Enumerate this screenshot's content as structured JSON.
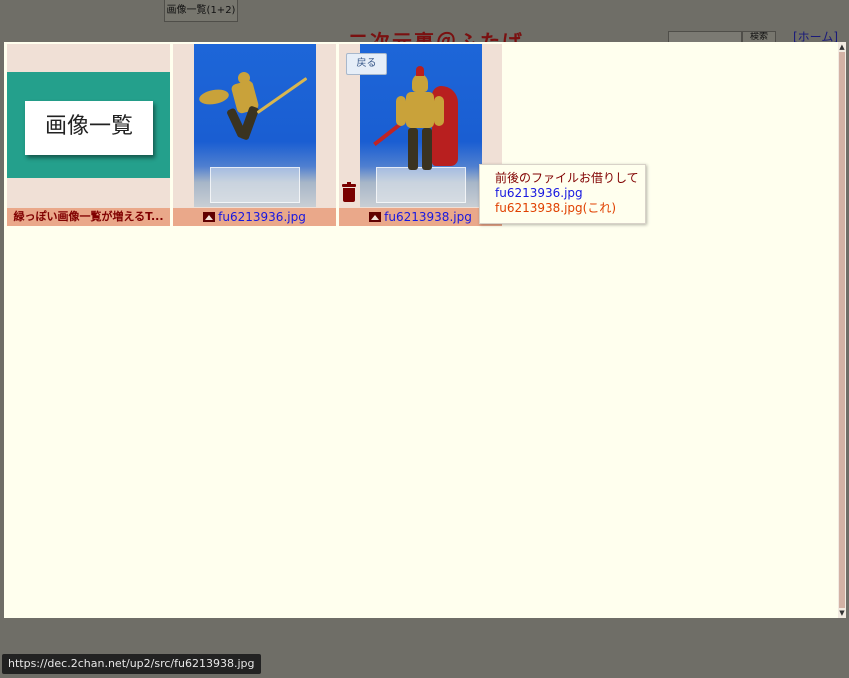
{
  "background_page": {
    "tab_label": "画像一覧(1+2)",
    "site_title": "二次元裏＠ふたば",
    "search_button": "検索",
    "home_link": "[ホーム]"
  },
  "overlay": {
    "back_button": "戻る",
    "tiles": [
      {
        "caption": "緑っぽい画像一覧が増えるT...",
        "thumb_text": "画像一覧"
      },
      {
        "caption": "fu6213936.jpg"
      },
      {
        "caption": "fu6213938.jpg"
      }
    ],
    "popup": {
      "line1": "前後のファイルお借りして",
      "line2": "fu6213936.jpg",
      "line3": "fu6213938.jpg(これ)"
    }
  },
  "status_bar": {
    "url": "https://dec.2chan.net/up2/src/fu6213938.jpg"
  },
  "colors": {
    "overlay_bg": "#ffffee",
    "tile_bg": "#f0e0d6",
    "caption_bg": "#eaa88a",
    "link": "#1818e0",
    "maroon": "#800000"
  }
}
